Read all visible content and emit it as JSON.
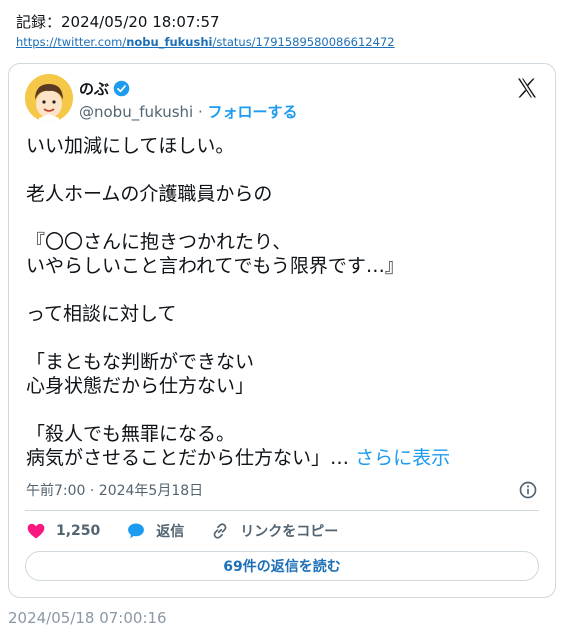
{
  "header": {
    "record_label": "記録：2024/05/20 18:07:57",
    "url_prefix": "https://twitter.com/",
    "url_user": "nobu_fukushi",
    "url_suffix": "/status/1791589580086612472"
  },
  "tweet": {
    "display_name": "のぶ",
    "handle": "@nobu_fukushi",
    "separator": " · ",
    "follow_label": "フォローする",
    "paragraphs": [
      "いい加減にしてほしい。",
      "老人ホームの介護職員からの",
      "『〇〇さんに抱きつかれたり、\nいやらしいこと言われてでもう限界です…』",
      "って相談に対して",
      "「まともな判断ができない\n心身状態だから仕方ない」",
      "「殺人でも無罪になる。\n病気がさせることだから仕方ない」…"
    ],
    "show_more_label": "さらに表示",
    "timestamp": "午前7:00 · 2024年5月18日",
    "like_count": "1,250",
    "reply_label": "返信",
    "copy_link_label": "リンクをコピー",
    "read_replies_label": "69件の返信を読む"
  },
  "footer": {
    "capture_time": "2024/05/18 07:00:16"
  },
  "colors": {
    "accent": "#1d9bf0",
    "like": "#f91880",
    "muted": "#536471",
    "border": "#cfd9de",
    "avatar_bg": "#f5c84a"
  },
  "icons": {
    "verified": "verified-badge-icon",
    "brand": "x-logo-icon",
    "info": "info-icon",
    "like": "heart-icon",
    "reply": "speech-bubble-icon",
    "copy_link": "link-icon"
  }
}
